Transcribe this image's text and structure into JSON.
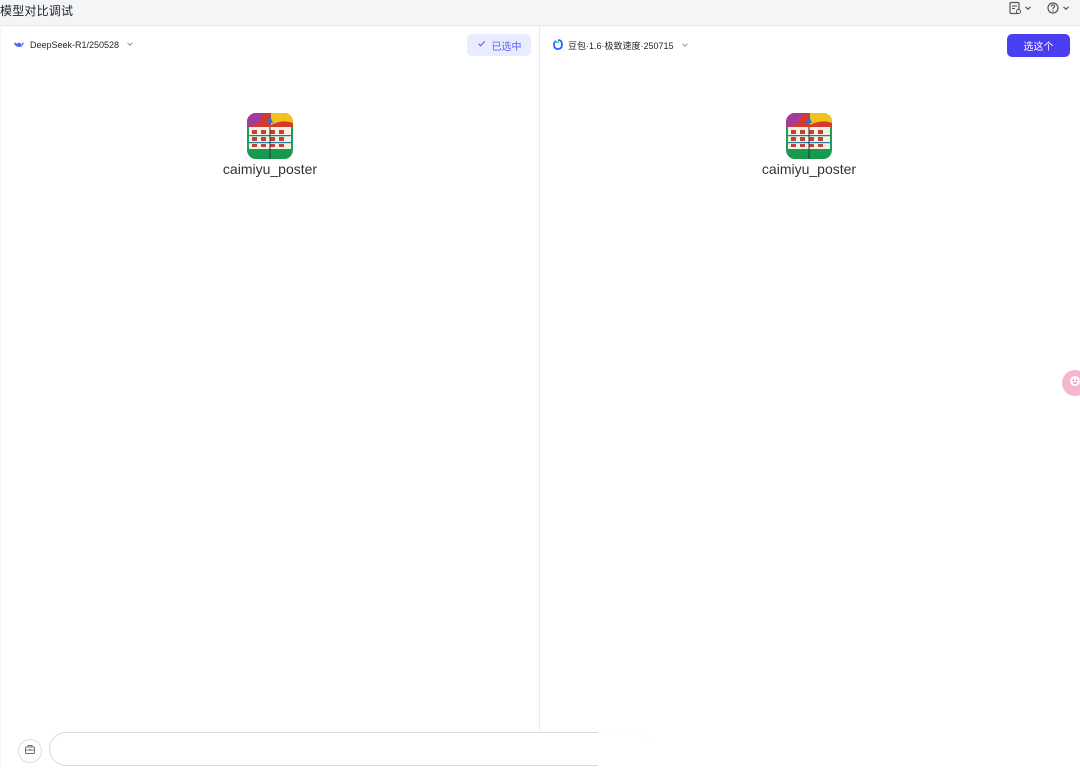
{
  "header": {
    "title": "模型对比调试"
  },
  "left_panel": {
    "model_name": "DeepSeek-R1/250528",
    "selected_label": "已选中",
    "file_name": "caimiyu_poster",
    "accent": "#5b5ff0"
  },
  "right_panel": {
    "model_name": "豆包·1.6·极致速度·250715",
    "choose_label": "选这个",
    "file_name": "caimiyu_poster",
    "accent": "#4a3ff0"
  },
  "composer": {
    "value": "",
    "placeholder": ""
  },
  "icons": {
    "top_left": "doc-settings-icon",
    "top_right": "help-icon",
    "deepseek": "deepseek-whale-icon",
    "doubao": "doubao-logo-icon",
    "toolbox": "toolbox-icon",
    "assistant": "assistant-face-icon"
  }
}
